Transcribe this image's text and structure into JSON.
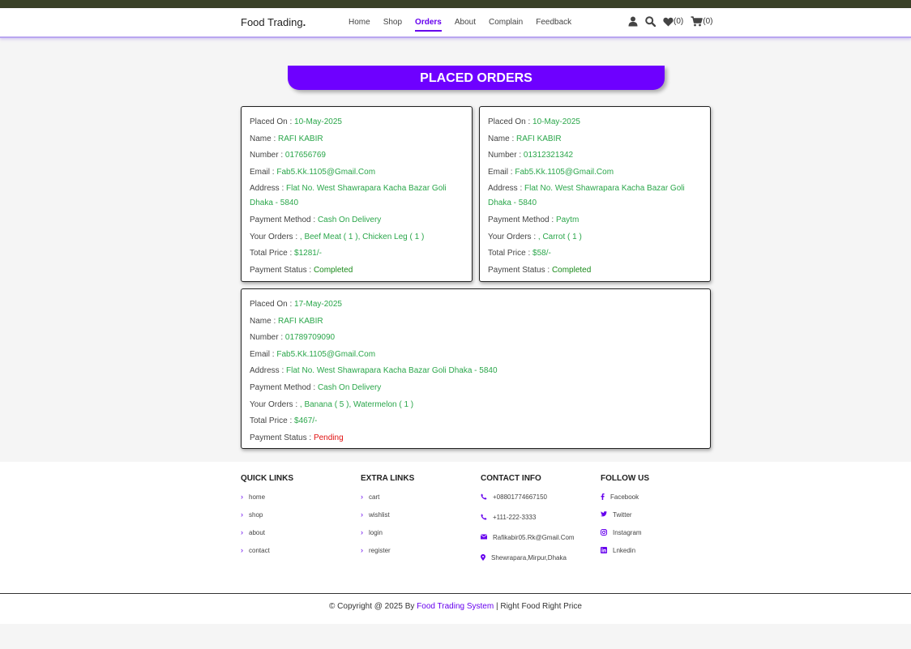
{
  "header": {
    "logo": "Food Trading",
    "logo_dot": ".",
    "nav": [
      {
        "label": "Home"
      },
      {
        "label": "Shop"
      },
      {
        "label": "Orders"
      },
      {
        "label": "About"
      },
      {
        "label": "Complain"
      },
      {
        "label": "Feedback"
      }
    ],
    "wishlist_count": "(0)",
    "cart_count": "(0)"
  },
  "page_title": "PLACED ORDERS",
  "labels": {
    "placed_on": "Placed On : ",
    "name": "Name : ",
    "number": "Number : ",
    "email": "Email : ",
    "address": "Address : ",
    "payment_method": "Payment Method : ",
    "your_orders": "Your Orders : ",
    "total_price": "Total Price : ",
    "payment_status": "Payment Status : "
  },
  "orders": [
    {
      "placed_on": "10-May-2025",
      "name": "RAFI KABIR",
      "number": "017656769",
      "email": "Fab5.Kk.1105@Gmail.Com",
      "address": "Flat No. West Shawrapara Kacha Bazar Goli Dhaka - 5840",
      "payment_method": "Cash On Delivery",
      "your_orders": ", Beef Meat ( 1 ), Chicken Leg ( 1 )",
      "total_price": "$1281/-",
      "payment_status": "Completed"
    },
    {
      "placed_on": "10-May-2025",
      "name": "RAFI KABIR",
      "number": "01312321342",
      "email": "Fab5.Kk.1105@Gmail.Com",
      "address": "Flat No. West Shawrapara Kacha Bazar Goli Dhaka - 5840",
      "payment_method": "Paytm",
      "your_orders": ", Carrot ( 1 )",
      "total_price": "$58/-",
      "payment_status": "Completed"
    },
    {
      "placed_on": "17-May-2025",
      "name": "RAFI KABIR",
      "number": "01789709090",
      "email": "Fab5.Kk.1105@Gmail.Com",
      "address": "Flat No. West Shawrapara Kacha Bazar Goli Dhaka - 5840",
      "payment_method": "Cash On Delivery",
      "your_orders": ", Banana ( 5 ), Watermelon ( 1 )",
      "total_price": "$467/-",
      "payment_status": "Pending"
    }
  ],
  "footer": {
    "quick_links": {
      "title": "QUICK LINKS",
      "items": [
        "home",
        "shop",
        "about",
        "contact"
      ]
    },
    "extra_links": {
      "title": "EXTRA LINKS",
      "items": [
        "cart",
        "wishlist",
        "login",
        "register"
      ]
    },
    "contact_info": {
      "title": "CONTACT INFO",
      "phone1": "+08801774667150",
      "phone2": "+111-222-3333",
      "email": "Rafikabir05.Rk@Gmail.Com",
      "address": "Shewrapara,Mirpur,Dhaka"
    },
    "follow_us": {
      "title": "FOLLOW US",
      "items": [
        "Facebook",
        "Twitter",
        "Instagram",
        "Lnkedin"
      ]
    },
    "copyright_prefix": "© Copyright @ 2025 By ",
    "copyright_brand": "Food Trading System",
    "copyright_suffix": " | Right Food Right Price"
  },
  "colors": {
    "accent": "#6e00ff",
    "value_green": "#2aa64a",
    "pending_red": "#e01010",
    "topbar": "#3a4128"
  }
}
